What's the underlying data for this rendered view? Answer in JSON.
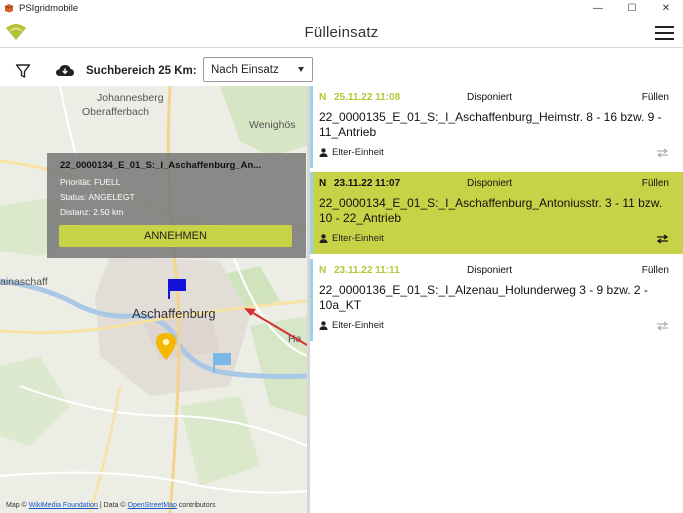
{
  "window": {
    "title": "PSIgridmobile",
    "controls": [
      "—",
      "☐",
      "✕"
    ]
  },
  "header": {
    "title": "Fülleinsatz"
  },
  "toolbar": {
    "search_label": "Suchbereich 25 Km:",
    "sort_select": {
      "value": "Nach Einsatz"
    }
  },
  "map": {
    "labels": {
      "johannesberg": "Johannesberg",
      "oberafferbach": "Oberafferbach",
      "wenighoesbach": "Wenighös",
      "mainaschaff": "ainaschaff",
      "aschaffenburg": "Aschaffenburg",
      "haibach": "Ha"
    },
    "popup": {
      "title": "22_0000134_E_01_S:_I_Aschaffenburg_An...",
      "priority": "Priorität: FUELL",
      "status": "Status: ANGELEGT",
      "distance": "Distanz: 2.50 km",
      "accept_label": "ANNEHMEN"
    },
    "attribution": {
      "prefix": "Map ©",
      "link1": "WikiMedia Foundation",
      "middle": "| Data ©",
      "link2": "OpenStreetMap",
      "suffix": "contributors"
    },
    "colors": {
      "flag_primary": "#1212d8",
      "flag_secondary": "#7ab8e8",
      "marker": "#f5b800",
      "arrow": "#d43030"
    }
  },
  "list": {
    "items": [
      {
        "flag": "N",
        "datetime": "25.11.22  11:08",
        "status": "Disponiert",
        "type": "Füllen",
        "name": "22_0000135_E_01_S:_I_Aschaffenburg_Heimstr. 8 - 16 bzw. 9 - 11_Antrieb",
        "unit": "Elter-Einheit",
        "selected": false
      },
      {
        "flag": "N",
        "datetime": "23.11.22  11:07",
        "status": "Disponiert",
        "type": "Füllen",
        "name": "22_0000134_E_01_S:_I_Aschaffenburg_Antoniusstr. 3 - 11 bzw. 10 - 22_Antrieb",
        "unit": "Elter-Einheit",
        "selected": true
      },
      {
        "flag": "N",
        "datetime": "23.11.22  11:11",
        "status": "Disponiert",
        "type": "Füllen",
        "name": "22_0000136_E_01_S:_I_Alzenau_Holunderweg 3 - 9 bzw. 2 - 10a_KT",
        "unit": "Elter-Einheit",
        "selected": false
      }
    ]
  },
  "colors": {
    "accent": "#c8d246",
    "card_accent": "#9bd1ea"
  }
}
